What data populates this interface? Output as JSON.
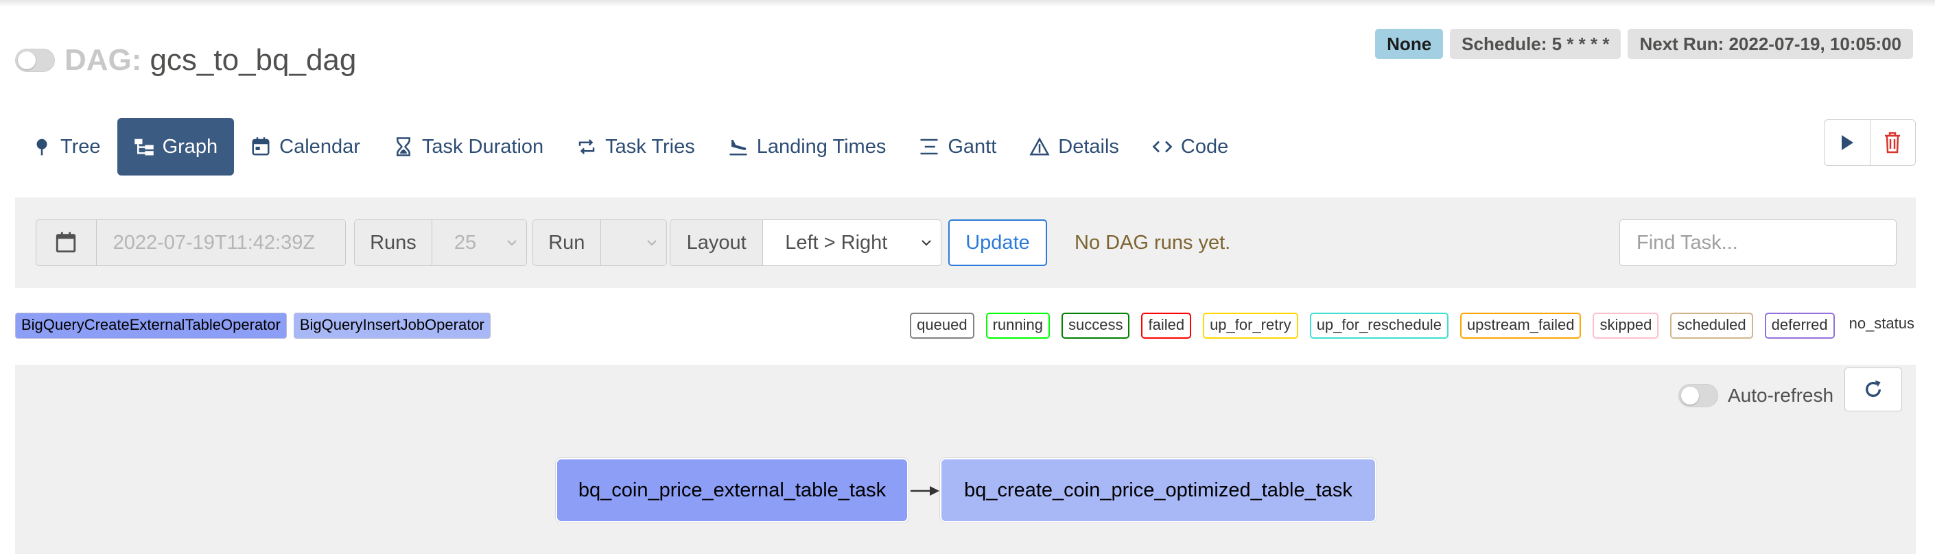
{
  "header": {
    "dag_label": "DAG:",
    "dag_id": "gcs_to_bq_dag",
    "badges": {
      "none": "None",
      "schedule": "Schedule: 5 * * * *",
      "next_run": "Next Run: 2022-07-19, 10:05:00"
    }
  },
  "nav": [
    {
      "label": "Tree",
      "icon": "tree-icon"
    },
    {
      "label": "Graph",
      "icon": "graph-icon",
      "active": true
    },
    {
      "label": "Calendar",
      "icon": "calendar-icon"
    },
    {
      "label": "Task Duration",
      "icon": "hourglass-icon"
    },
    {
      "label": "Task Tries",
      "icon": "repeat-icon"
    },
    {
      "label": "Landing Times",
      "icon": "plane-landing-icon"
    },
    {
      "label": "Gantt",
      "icon": "gantt-icon"
    },
    {
      "label": "Details",
      "icon": "warning-triangle-icon"
    },
    {
      "label": "Code",
      "icon": "code-icon"
    }
  ],
  "controls": {
    "date_placeholder": "2022-07-19T11:42:39Z",
    "runs_label": "Runs",
    "runs_value": "25",
    "run_label": "Run",
    "layout_label": "Layout",
    "layout_value": "Left > Right",
    "update_label": "Update",
    "no_runs_text": "No DAG runs yet.",
    "find_placeholder": "Find Task..."
  },
  "operators": [
    {
      "name": "BigQueryCreateExternalTableOperator",
      "color": "#8c9ef5"
    },
    {
      "name": "BigQueryInsertJobOperator",
      "color": "#a8b8f7"
    }
  ],
  "states": [
    {
      "name": "queued",
      "color": "#808080"
    },
    {
      "name": "running",
      "color": "#00ff00"
    },
    {
      "name": "success",
      "color": "#008000"
    },
    {
      "name": "failed",
      "color": "#ff0000"
    },
    {
      "name": "up_for_retry",
      "color": "#ffd700"
    },
    {
      "name": "up_for_reschedule",
      "color": "#40e0d0"
    },
    {
      "name": "upstream_failed",
      "color": "#ffa500"
    },
    {
      "name": "skipped",
      "color": "#ffc0cb"
    },
    {
      "name": "scheduled",
      "color": "#d2b48c"
    },
    {
      "name": "deferred",
      "color": "#9370db"
    },
    {
      "name": "no_status",
      "color": ""
    }
  ],
  "graph": {
    "autorefresh_label": "Auto-refresh",
    "nodes": [
      {
        "label": "bq_coin_price_external_table_task",
        "color": "#8c9ef5"
      },
      {
        "label": "bq_create_coin_price_optimized_table_task",
        "color": "#a8b8f7"
      }
    ]
  }
}
